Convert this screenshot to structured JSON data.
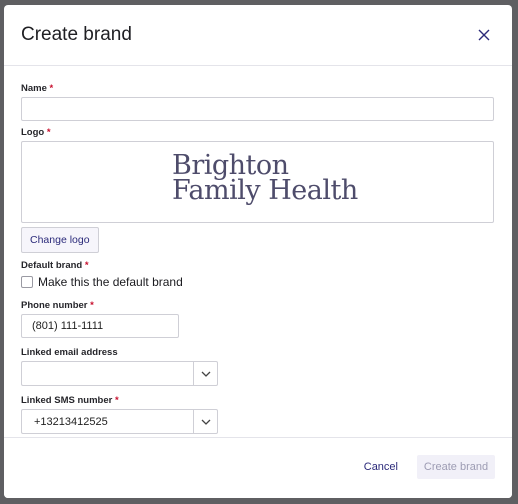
{
  "modal": {
    "title": "Create brand"
  },
  "fields": {
    "name": {
      "label": "Name",
      "required_mark": "*",
      "value": ""
    },
    "logo": {
      "label": "Logo",
      "required_mark": "*",
      "logo_lines": [
        "Brighton",
        "Family Health"
      ],
      "change_label": "Change logo"
    },
    "default_brand": {
      "label": "Default brand",
      "required_mark": "*",
      "checkbox_label": "Make this the default brand",
      "checked": false
    },
    "phone": {
      "label": "Phone number",
      "required_mark": "*",
      "value": "(801) 111-1111"
    },
    "linked_email": {
      "label": "Linked email address",
      "value": ""
    },
    "linked_sms": {
      "label": "Linked SMS number",
      "required_mark": "*",
      "value": "+13213412525"
    }
  },
  "footer": {
    "cancel_label": "Cancel",
    "create_label": "Create brand"
  },
  "icons": {
    "close": "close-icon",
    "chevron": "chevron-down-icon"
  },
  "colors": {
    "accent": "#2b2a7a",
    "required": "#c8102e",
    "logo": "#4e4c6b"
  }
}
